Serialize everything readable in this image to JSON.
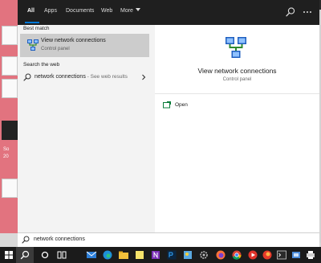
{
  "search_tabs": [
    {
      "label": "All",
      "active": true
    },
    {
      "label": "Apps"
    },
    {
      "label": "Documents"
    },
    {
      "label": "Web"
    },
    {
      "label": "More",
      "has_dropdown": true
    }
  ],
  "topbar_icons": [
    "feedback-icon",
    "more-options-icon"
  ],
  "left_pane": {
    "best_match_header": "Best match",
    "best_match": {
      "title": "View network connections",
      "subtitle": "Control panel",
      "icon": "network-connections-icon"
    },
    "web_header": "Search the web",
    "web_result": {
      "query": "network connections",
      "suffix": " - See web results",
      "icon": "search-icon"
    }
  },
  "right_pane": {
    "title": "View network connections",
    "subtitle": "Control panel",
    "icon": "network-connections-icon",
    "actions": [
      {
        "label": "Open",
        "icon": "open-icon"
      }
    ]
  },
  "search_box": {
    "value": "network connections",
    "icon": "search-icon"
  },
  "desktop": {
    "label_fragment_1": "So",
    "label_fragment_2": "20"
  },
  "taskbar": {
    "items": [
      "windows-start-icon",
      "search-icon",
      "task-view-icon",
      "mail-icon",
      "edge-icon",
      "file-explorer-icon",
      "sticky-notes-icon",
      "onenote-icon",
      "photoshop-icon",
      "paint-icon",
      "settings-icon",
      "firefox-icon",
      "chrome-icon",
      "media-icon",
      "firefox-dev-icon",
      "opera-icon",
      "terminal-icon",
      "system-app-icon",
      "printer-icon"
    ]
  },
  "colors": {
    "accent": "#0078d7",
    "topbar": "#1f1f1f",
    "selected": "#cccccc",
    "desktop_pink": "#e2737f",
    "taskbar": "#1b1b1b"
  }
}
